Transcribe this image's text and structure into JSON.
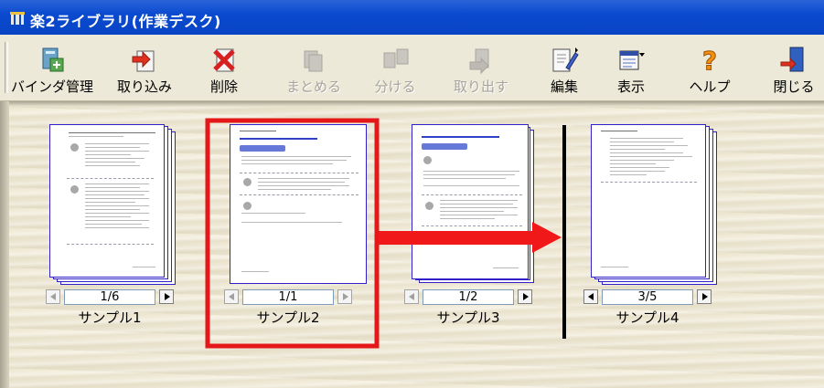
{
  "window": {
    "title": "楽2ライブラリ(作業デスク)"
  },
  "toolbar": {
    "buttons": [
      {
        "label": "バインダ管理",
        "icon": "binder-manage-icon",
        "enabled": true
      },
      {
        "label": "取り込み",
        "icon": "import-icon",
        "enabled": true
      },
      {
        "label": "削除",
        "icon": "delete-icon",
        "enabled": true
      },
      {
        "label": "まとめる",
        "icon": "combine-icon",
        "enabled": false
      },
      {
        "label": "分ける",
        "icon": "split-icon",
        "enabled": false
      },
      {
        "label": "取り出す",
        "icon": "extract-icon",
        "enabled": false
      },
      {
        "label": "編集",
        "icon": "edit-icon",
        "enabled": true
      },
      {
        "label": "表示",
        "icon": "view-icon",
        "enabled": true
      },
      {
        "label": "ヘルプ",
        "icon": "help-icon",
        "enabled": true
      },
      {
        "label": "閉じる",
        "icon": "close-icon",
        "enabled": true
      }
    ]
  },
  "binders": [
    {
      "name": "サンプル1",
      "page": "1/6"
    },
    {
      "name": "サンプル2",
      "page": "1/1",
      "selected": true
    },
    {
      "name": "サンプル3",
      "page": "1/2"
    },
    {
      "name": "サンプル4",
      "page": "3/5"
    }
  ],
  "colors": {
    "selection": "#e41818",
    "arrow": "#f01818",
    "divider": "#000000",
    "titlebar": "#0a4ad0",
    "page_border": "#3020c8"
  }
}
